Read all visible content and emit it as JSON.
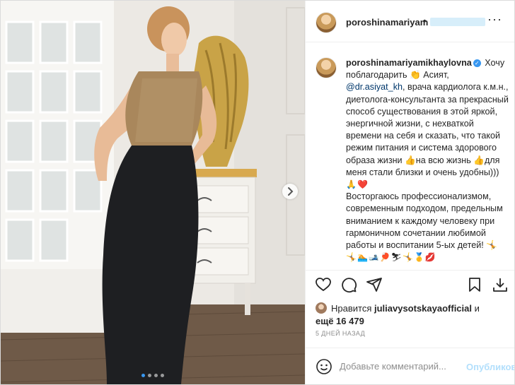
{
  "post": {
    "author": "poroshinamariyam",
    "header_dot": "•",
    "more": "···",
    "carousel_slides": 4,
    "carousel_current": 1
  },
  "caption": {
    "author": "poroshinamariyamikhaylovna",
    "verified_icon": "verified-badge-icon",
    "text_1": "Хочу поблагодарить 👏 Асият, ",
    "mention": "@dr.asiyat_kh",
    "text_2": ", врача кардиолога к.м.н., диетолога-консультанта за прекрасный способ существования в этой яркой, энергичной жизни, с нехваткой времени на себя и сказать, что такой режим питания и система здорового образа жизни 👍на всю жизнь 👍для меня стали близки и очень удобны)))",
    "emoji_row_1": "🙏❤️",
    "text_3": "Восторгаюсь профессионализмом, современным подходом, предельным вниманием к каждому человеку при гармоничном сочетании любимой работы и воспитании 5-ых детей! 🤸",
    "emoji_row_2": "🤸🏊🎿🏓⛷🤸🥇💋"
  },
  "likes": {
    "prefix": "Нравится ",
    "user": "juliavysotskayaofficial",
    "conj": " и",
    "others": "ещё 16 479"
  },
  "time": "5 ДНЕЙ НАЗАД",
  "comment": {
    "placeholder": "Добавьте комментарий...",
    "publish": "Опубликовать"
  },
  "colors": {
    "link": "#00376b",
    "verified": "#3897f0",
    "publish_disabled": "#b2dffc",
    "muted": "#8e8e8e"
  }
}
